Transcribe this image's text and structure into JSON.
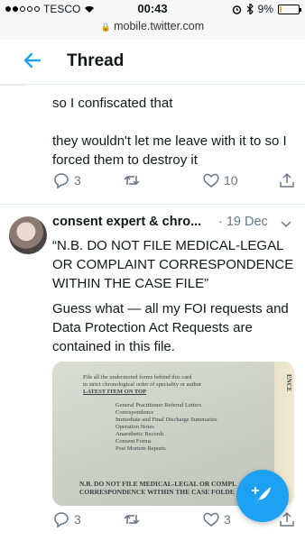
{
  "status_bar": {
    "carrier": "TESCO",
    "time": "00:43",
    "battery": "9%",
    "battery_level": 0.09,
    "url": "mobile.twitter.com"
  },
  "header": {
    "title": "Thread"
  },
  "tweets": [
    {
      "lines": [
        "so I confiscated that",
        "",
        "they wouldn't let me leave with it to so I forced them to destroy it"
      ],
      "replies": "3",
      "retweets": "",
      "likes": "10"
    },
    {
      "author": "consent expert & chro...",
      "date": "19 Dec",
      "text_1": "“N.B. DO NOT FILE MEDICAL-LEGAL OR COMPLAINT CORRESPONDENCE WITHIN THE CASE FILE”",
      "text_2": "Guess what — all my FOI requests and Data Protection Act Requests are contained in this file.",
      "replies": "3",
      "retweets": "",
      "likes": "3",
      "image": {
        "label_tab": "ENCE",
        "lines": [
          "File all the undermoted forms behind this card",
          "in strict chronological order of speciality or author",
          "LATEST ITEM ON TOP",
          "General Practitioner Referral Letters",
          "Correspondence",
          "Immediate and Final Discharge Summaries",
          "Operation Notes",
          "Anaesthetic Records",
          "Consent Forms",
          "Post Mortem Reports",
          "N.B. DO NOT FILE MEDICAL-LEGAL OR COMPL",
          "CORRESPONDENCE WITHIN THE CASE FOLDE"
        ]
      }
    }
  ],
  "colors": {
    "accent": "#1da1f2",
    "muted": "#657786",
    "text": "#14171a"
  }
}
